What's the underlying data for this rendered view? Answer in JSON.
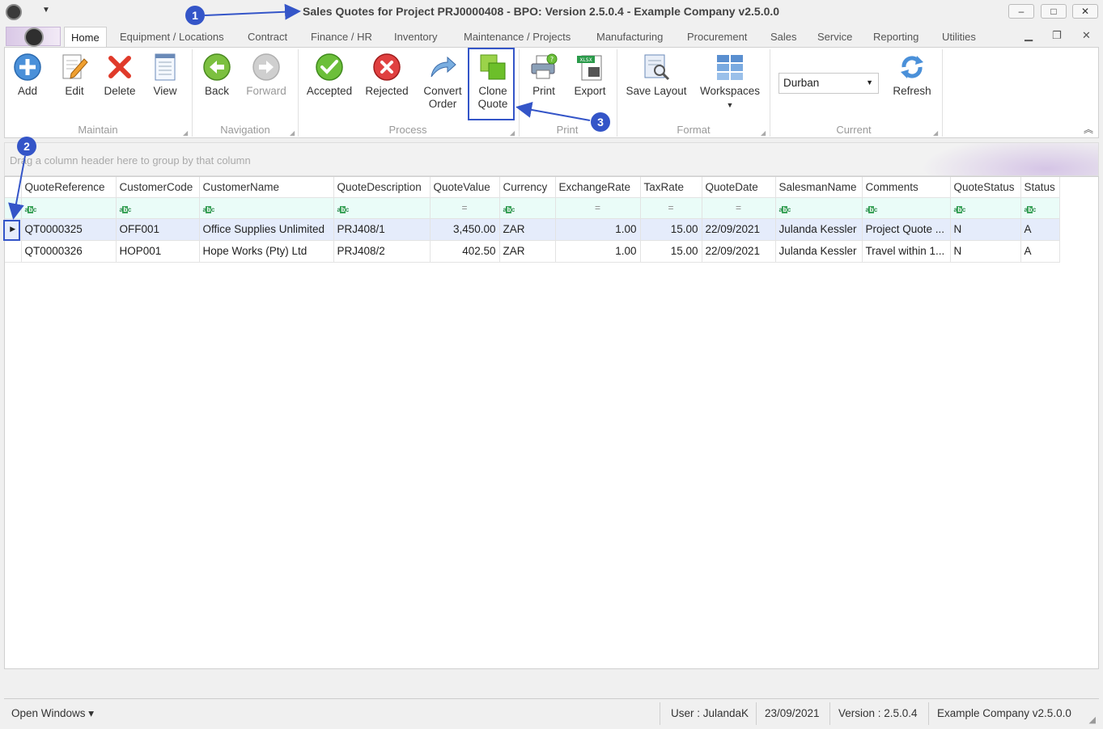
{
  "window": {
    "title": "Sales Quotes for Project PRJ0000408 - BPO: Version 2.5.0.4 - Example Company v2.5.0.0",
    "minimize": "–",
    "restore": "□",
    "close": "✕"
  },
  "ribbon_tabs": [
    "Home",
    "Equipment / Locations",
    "Contract",
    "Finance / HR",
    "Inventory",
    "Maintenance / Projects",
    "Manufacturing",
    "Procurement",
    "Sales",
    "Service",
    "Reporting",
    "Utilities"
  ],
  "ribbon": {
    "maintain": {
      "label": "Maintain",
      "add": "Add",
      "edit": "Edit",
      "delete": "Delete",
      "view": "View"
    },
    "navigation": {
      "label": "Navigation",
      "back": "Back",
      "forward": "Forward"
    },
    "process": {
      "label": "Process",
      "accepted": "Accepted",
      "rejected": "Rejected",
      "convert_1": "Convert",
      "convert_2": "Order",
      "clone_1": "Clone",
      "clone_2": "Quote"
    },
    "print": {
      "label": "Print",
      "print": "Print",
      "export": "Export"
    },
    "format": {
      "label": "Format",
      "save_layout": "Save Layout",
      "workspaces": "Workspaces"
    },
    "current": {
      "label": "Current",
      "site": "Durban",
      "refresh": "Refresh"
    }
  },
  "group_panel_hint": "Drag a column header here to group by that column",
  "grid": {
    "columns": [
      "QuoteReference",
      "CustomerCode",
      "CustomerName",
      "QuoteDescription",
      "QuoteValue",
      "Currency",
      "ExchangeRate",
      "TaxRate",
      "QuoteDate",
      "SalesmanName",
      "Comments",
      "QuoteStatus",
      "Status"
    ],
    "rows": [
      [
        "QT0000325",
        "OFF001",
        "Office Supplies Unlimited",
        "PRJ408/1",
        "3,450.00",
        "ZAR",
        "1.00",
        "15.00",
        "22/09/2021",
        "Julanda Kessler",
        "Project Quote ...",
        "N",
        "A"
      ],
      [
        "QT0000326",
        "HOP001",
        "Hope Works (Pty) Ltd",
        "PRJ408/2",
        "402.50",
        "ZAR",
        "1.00",
        "15.00",
        "22/09/2021",
        "Julanda Kessler",
        "Travel within 1...",
        "N",
        "A"
      ]
    ]
  },
  "statusbar": {
    "open_windows": "Open Windows ▾",
    "user": "User : JulandaK",
    "date": "23/09/2021",
    "version": "Version : 2.5.0.4",
    "company": "Example Company v2.5.0.0"
  },
  "callouts": [
    "1",
    "2",
    "3"
  ],
  "colors": {
    "callout": "#3455c8",
    "selected_row": "#e5ecfb",
    "filter_row": "#eafcf8"
  }
}
